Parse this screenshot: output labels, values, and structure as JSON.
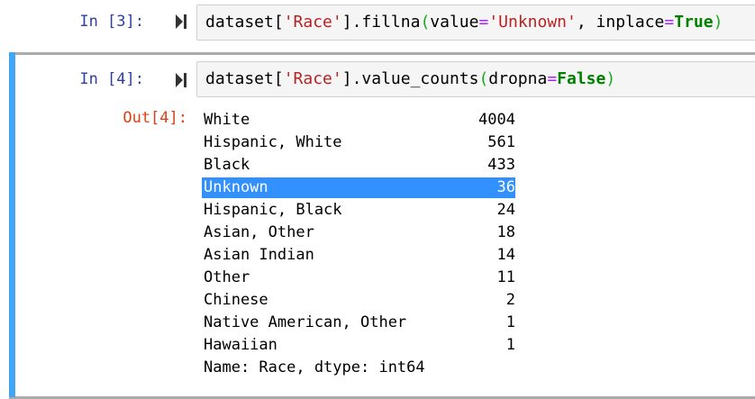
{
  "cells": [
    {
      "prompt": "In [3]:",
      "code": [
        {
          "t": "dataset[",
          "c": ""
        },
        {
          "t": "'Race'",
          "c": "str"
        },
        {
          "t": "].fillna",
          "c": ""
        },
        {
          "t": "(",
          "c": "par"
        },
        {
          "t": "value",
          "c": ""
        },
        {
          "t": "=",
          "c": "op"
        },
        {
          "t": "'Unknown'",
          "c": "str"
        },
        {
          "t": ", inplace",
          "c": ""
        },
        {
          "t": "=",
          "c": "op"
        },
        {
          "t": "True",
          "c": "kw"
        },
        {
          "t": ")",
          "c": "par"
        }
      ]
    },
    {
      "prompt": "In [4]:",
      "code": [
        {
          "t": "dataset[",
          "c": ""
        },
        {
          "t": "'Race'",
          "c": "str"
        },
        {
          "t": "].value_counts",
          "c": ""
        },
        {
          "t": "(",
          "c": "par"
        },
        {
          "t": "dropna",
          "c": ""
        },
        {
          "t": "=",
          "c": "op"
        },
        {
          "t": "False",
          "c": "kw"
        },
        {
          "t": ")",
          "c": "par"
        }
      ],
      "out_prompt": "Out[4]:",
      "output": {
        "rows": [
          {
            "label": "White",
            "count": "4004"
          },
          {
            "label": "Hispanic, White",
            "count": "561"
          },
          {
            "label": "Black",
            "count": "433"
          },
          {
            "label": "Unknown",
            "count": "36",
            "selected": true
          },
          {
            "label": "Hispanic, Black",
            "count": "24"
          },
          {
            "label": "Asian, Other",
            "count": "18"
          },
          {
            "label": "Asian Indian",
            "count": "14"
          },
          {
            "label": "Other",
            "count": "11"
          },
          {
            "label": "Chinese",
            "count": "2"
          },
          {
            "label": "Native American, Other",
            "count": "1"
          },
          {
            "label": "Hawaiian",
            "count": "1"
          }
        ],
        "footer": "Name: Race, dtype: int64"
      }
    }
  ],
  "colors": {
    "selected_cell_bar": "#42a5f5",
    "selection": "#3390ff",
    "prompt_in": "#303f9f",
    "prompt_out": "#d84315"
  }
}
